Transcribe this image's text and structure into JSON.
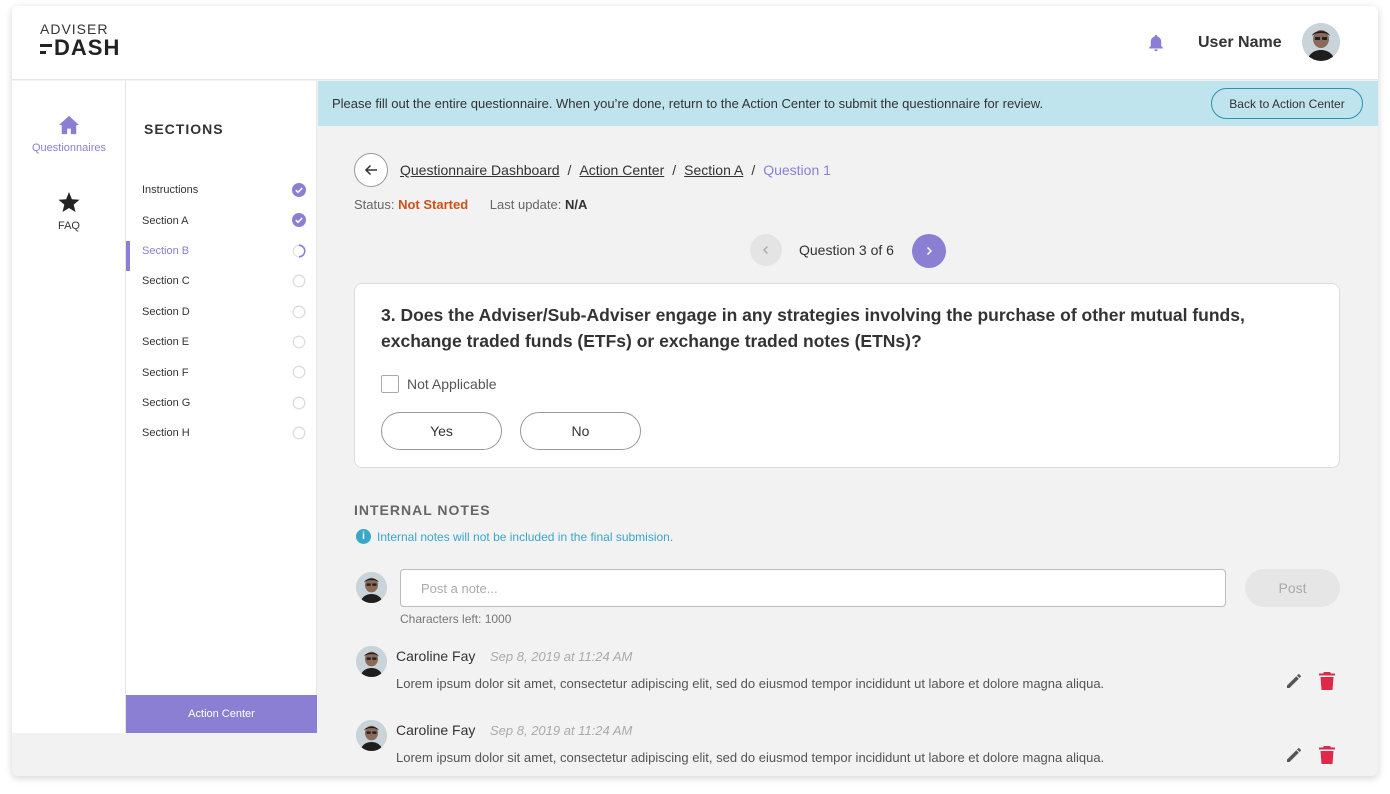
{
  "brand": {
    "line1": "ADVISER",
    "line2": "DASH"
  },
  "header": {
    "username": "User Name",
    "bell_icon": "bell-icon"
  },
  "nav": {
    "items": [
      {
        "label": "Questionnaires",
        "icon": "home-icon",
        "active": true
      },
      {
        "label": "FAQ",
        "icon": "star-icon",
        "active": false
      }
    ]
  },
  "sections": {
    "title": "SECTIONS",
    "items": [
      {
        "label": "Instructions",
        "status": "complete"
      },
      {
        "label": "Section A",
        "status": "complete"
      },
      {
        "label": "Section B",
        "status": "in-progress"
      },
      {
        "label": "Section C",
        "status": "empty"
      },
      {
        "label": "Section D",
        "status": "empty"
      },
      {
        "label": "Section E",
        "status": "empty"
      },
      {
        "label": "Section F",
        "status": "empty"
      },
      {
        "label": "Section G",
        "status": "empty"
      },
      {
        "label": "Section H",
        "status": "empty"
      }
    ],
    "action_center": "Action Center"
  },
  "banner": {
    "text": "Please fill out the entire questionnaire. When you’re done, return to the Action Center to submit the questionnaire for review.",
    "button": "Back to Action Center"
  },
  "breadcrumb": {
    "items": [
      "Questionnaire Dashboard",
      "Action Center",
      "Section A"
    ],
    "current": "Question 1",
    "separator": "/"
  },
  "status": {
    "label": "Status:",
    "value": "Not Started",
    "last_update_label": "Last update:",
    "last_update_value": "N/A"
  },
  "pager": {
    "text": "Question 3 of 6"
  },
  "question": {
    "text": "3. Does the Adviser/Sub-Adviser engage in any strategies involving the purchase of other mutual funds, exchange traded funds (ETFs) or exchange traded notes (ETNs)?",
    "not_applicable": "Not Applicable",
    "yes": "Yes",
    "no": "No"
  },
  "notes": {
    "title": "INTERNAL NOTES",
    "info": "Internal notes will not be included in the final submision.",
    "input_placeholder": "Post a note...",
    "post": "Post",
    "chars_left": "Characters left: 1000",
    "items": [
      {
        "author": "Caroline Fay",
        "time": "Sep 8, 2019 at 11:24 AM",
        "body": "Lorem ipsum dolor sit amet, consectetur adipiscing elit, sed do eiusmod tempor incididunt ut labore et dolore magna aliqua."
      },
      {
        "author": "Caroline Fay",
        "time": "Sep 8, 2019 at 11:24 AM",
        "body": "Lorem ipsum dolor sit amet, consectetur adipiscing elit, sed do eiusmod tempor incididunt ut labore et dolore magna aliqua."
      }
    ]
  },
  "colors": {
    "accent": "#8b7fd4",
    "banner": "#bfe4ee",
    "status": "#d0501a",
    "info": "#3aa7c9",
    "delete": "#e0294a"
  }
}
